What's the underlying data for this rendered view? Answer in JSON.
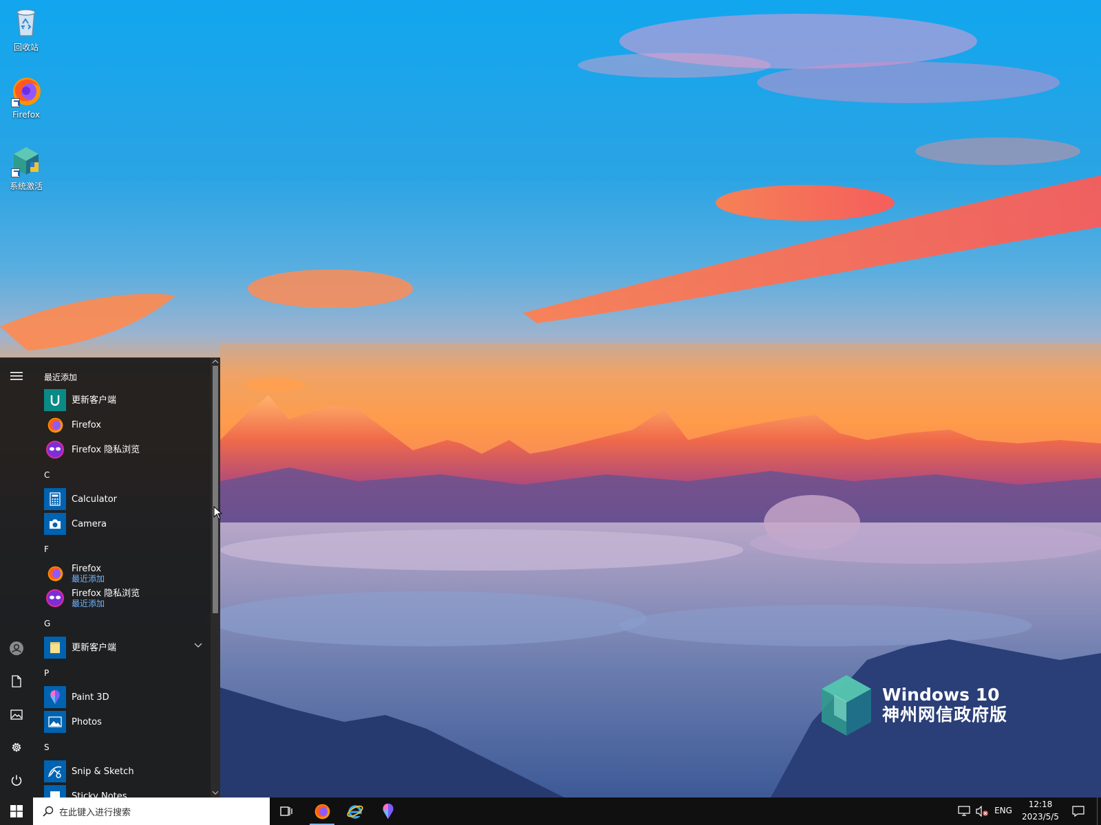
{
  "desktop": {
    "icons": [
      {
        "label": "回收站",
        "icon": "recycle-bin-icon"
      },
      {
        "label": "Firefox",
        "icon": "firefox-icon"
      },
      {
        "label": "系统激活",
        "icon": "activation-icon"
      }
    ],
    "watermark": {
      "line1": "Windows 10",
      "line2": "神州网信政府版"
    }
  },
  "start_menu": {
    "rail": {
      "menu_icon": "hamburger-icon",
      "user_icon": "user-avatar-icon",
      "documents_icon": "document-icon",
      "pictures_icon": "pictures-icon",
      "settings_icon": "gear-icon",
      "power_icon": "power-icon"
    },
    "sections": {
      "recent": "最近添加",
      "c": "C",
      "f": "F",
      "g": "G",
      "p": "P",
      "s": "S"
    },
    "recent_apps": [
      {
        "name": "更新客户端",
        "icon": "update-client-icon"
      },
      {
        "name": "Firefox",
        "icon": "firefox-icon"
      },
      {
        "name": "Firefox 隐私浏览",
        "icon": "firefox-private-icon"
      }
    ],
    "c_apps": [
      {
        "name": "Calculator",
        "icon": "calculator-icon"
      },
      {
        "name": "Camera",
        "icon": "camera-icon"
      }
    ],
    "f_apps": [
      {
        "name": "Firefox",
        "sub": "最近添加",
        "icon": "firefox-icon"
      },
      {
        "name": "Firefox 隐私浏览",
        "sub": "最近添加",
        "icon": "firefox-private-icon"
      }
    ],
    "g_apps": [
      {
        "name": "更新客户端",
        "icon": "folder-icon"
      }
    ],
    "p_apps": [
      {
        "name": "Paint 3D",
        "icon": "paint3d-icon"
      },
      {
        "name": "Photos",
        "icon": "photos-icon"
      }
    ],
    "s_apps": [
      {
        "name": "Snip & Sketch",
        "icon": "snip-sketch-icon"
      },
      {
        "name": "Sticky Notes",
        "icon": "sticky-notes-icon"
      }
    ]
  },
  "taskbar": {
    "search_placeholder": "在此键入进行搜索",
    "pinned": [
      "firefox-icon",
      "internet-explorer-icon",
      "paint3d-icon"
    ],
    "tray": {
      "language": "ENG",
      "time": "12:18",
      "date": "2023/5/5"
    }
  },
  "colors": {
    "accent": "#0078d7",
    "start_bg": "#1e1e1e",
    "recent_label": "#74b6ff"
  }
}
